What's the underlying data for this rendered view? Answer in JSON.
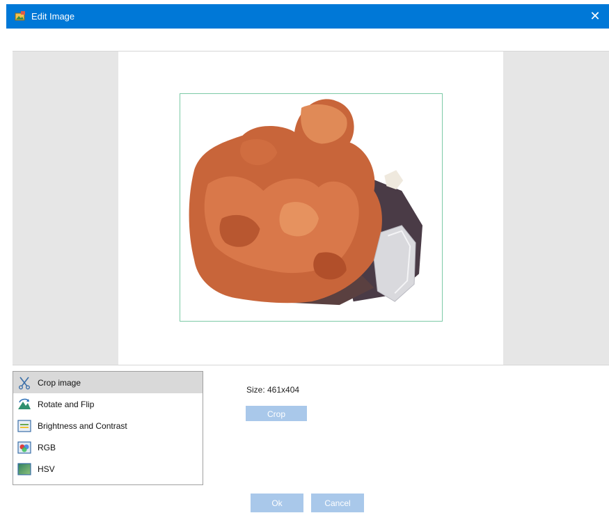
{
  "window": {
    "title": "Edit Image",
    "close_glyph": "✕"
  },
  "preview": {
    "icon": "mineral-photo"
  },
  "tools": {
    "items": [
      {
        "label": "Crop image",
        "icon": "scissors-icon",
        "selected": true
      },
      {
        "label": "Rotate and Flip",
        "icon": "rotate-flip-icon"
      },
      {
        "label": "Brightness and Contrast",
        "icon": "brightness-contrast-icon"
      },
      {
        "label": "RGB",
        "icon": "rgb-icon"
      },
      {
        "label": "HSV",
        "icon": "hsv-icon"
      }
    ]
  },
  "crop_panel": {
    "size_text": "Size: 461x404",
    "crop_label": "Crop"
  },
  "footer": {
    "ok_label": "Ok",
    "cancel_label": "Cancel"
  },
  "colors": {
    "titlebar": "#0078d7",
    "button": "#a9c8ea",
    "crop_frame": "#7ccaa6",
    "selected_row": "#d9d9d9"
  }
}
